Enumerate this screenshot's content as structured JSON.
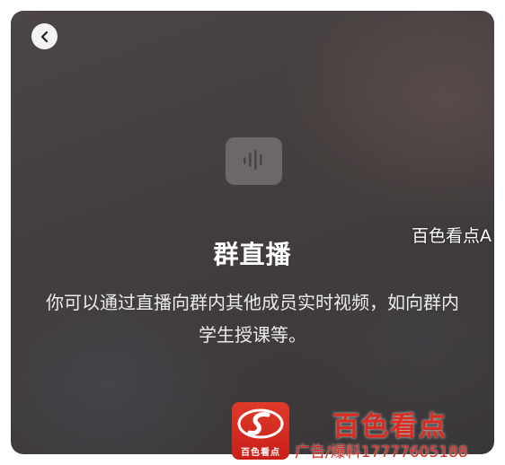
{
  "modal": {
    "title": "群直播",
    "description": "你可以通过直播向群内其他成员实时视频，如向群内学生授课等。",
    "side_label": "百色看点A"
  },
  "icons": {
    "back": "chevron-left-icon",
    "audio": "audio-waveform-icon"
  },
  "watermark": {
    "logo_caption": "百色看点",
    "title": "百色看点",
    "contact": "广告/爆料17777605188"
  },
  "colors": {
    "modal_background": "#433d3d",
    "icon_tile": "#6c6868",
    "watermark_red": "#d92b20"
  }
}
